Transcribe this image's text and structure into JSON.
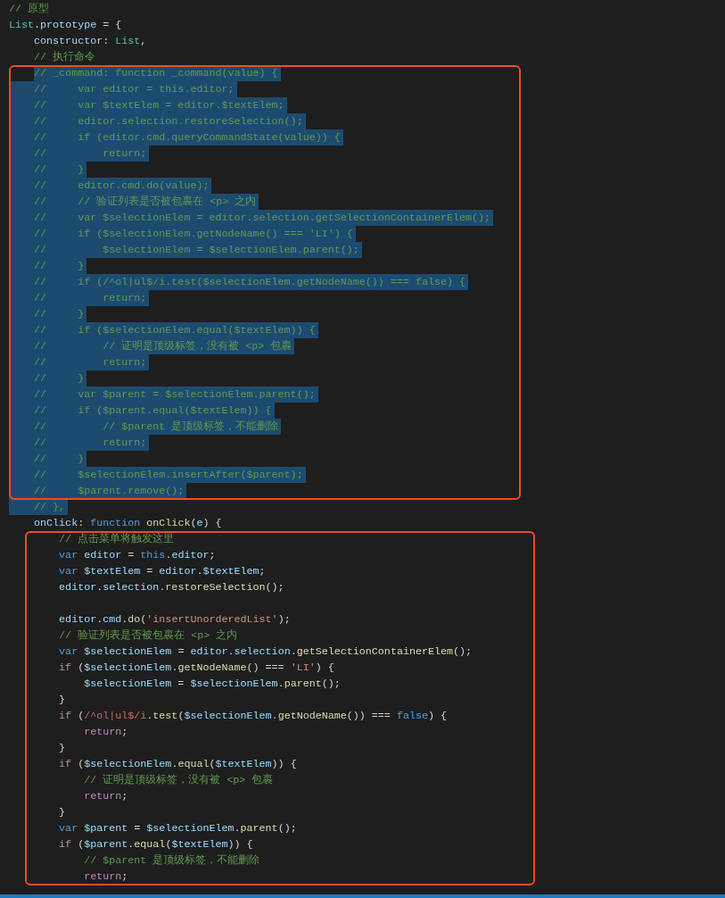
{
  "editor": {
    "lines": [
      {
        "kind": "code",
        "selected": false,
        "tokens": [
          {
            "kind": "comment",
            "text": "// 原型"
          }
        ]
      },
      {
        "kind": "code",
        "selected": false,
        "tokens": [
          {
            "kind": "type",
            "text": "List"
          },
          {
            "kind": "punct",
            "text": "."
          },
          {
            "kind": "ident",
            "text": "prototype"
          },
          {
            "kind": "punct",
            "text": " = {"
          }
        ]
      },
      {
        "kind": "code",
        "selected": false,
        "tokens": [
          {
            "kind": "ident",
            "text": "    constructor"
          },
          {
            "kind": "punct",
            "text": ": "
          },
          {
            "kind": "type",
            "text": "List"
          },
          {
            "kind": "punct",
            "text": ","
          }
        ]
      },
      {
        "kind": "code",
        "selected": false,
        "tokens": [
          {
            "kind": "comment",
            "text": "    // 执行命令"
          }
        ]
      },
      {
        "kind": "code",
        "selected": true,
        "selection_starts_at_text": true,
        "tokens": [
          {
            "kind": "comment",
            "text": "    // _command: function _command(value) {"
          }
        ]
      },
      {
        "kind": "code",
        "selected": true,
        "tokens": [
          {
            "kind": "comment",
            "text": "    //     var editor = this.editor;"
          }
        ]
      },
      {
        "kind": "code",
        "selected": true,
        "tokens": [
          {
            "kind": "comment",
            "text": "    //     var $textElem = editor.$textElem;"
          }
        ]
      },
      {
        "kind": "code",
        "selected": true,
        "tokens": [
          {
            "kind": "comment",
            "text": "    //     editor.selection.restoreSelection();"
          }
        ]
      },
      {
        "kind": "code",
        "selected": true,
        "tokens": [
          {
            "kind": "comment",
            "text": "    //     if (editor.cmd.queryCommandState(value)) {"
          }
        ]
      },
      {
        "kind": "code",
        "selected": true,
        "tokens": [
          {
            "kind": "comment",
            "text": "    //         return;"
          }
        ]
      },
      {
        "kind": "code",
        "selected": true,
        "tokens": [
          {
            "kind": "comment",
            "text": "    //     }"
          }
        ]
      },
      {
        "kind": "code",
        "selected": true,
        "tokens": [
          {
            "kind": "comment",
            "text": "    //     editor.cmd.do(value);"
          }
        ]
      },
      {
        "kind": "code",
        "selected": true,
        "tokens": [
          {
            "kind": "comment",
            "text": "    //     // 验证列表是否被包裹在 <p> 之内"
          }
        ]
      },
      {
        "kind": "code",
        "selected": true,
        "tokens": [
          {
            "kind": "comment",
            "text": "    //     var $selectionElem = editor.selection.getSelectionContainerElem();"
          }
        ]
      },
      {
        "kind": "code",
        "selected": true,
        "tokens": [
          {
            "kind": "comment",
            "text": "    //     if ($selectionElem.getNodeName() === 'LI') {"
          }
        ]
      },
      {
        "kind": "code",
        "selected": true,
        "tokens": [
          {
            "kind": "comment",
            "text": "    //         $selectionElem = $selectionElem.parent();"
          }
        ]
      },
      {
        "kind": "code",
        "selected": true,
        "tokens": [
          {
            "kind": "comment",
            "text": "    //     }"
          }
        ]
      },
      {
        "kind": "code",
        "selected": true,
        "tokens": [
          {
            "kind": "comment",
            "text": "    //     if (/^ol|ul$/i.test($selectionElem.getNodeName()) === false) {"
          }
        ]
      },
      {
        "kind": "code",
        "selected": true,
        "tokens": [
          {
            "kind": "comment",
            "text": "    //         return;"
          }
        ]
      },
      {
        "kind": "code",
        "selected": true,
        "tokens": [
          {
            "kind": "comment",
            "text": "    //     }"
          }
        ]
      },
      {
        "kind": "code",
        "selected": true,
        "tokens": [
          {
            "kind": "comment",
            "text": "    //     if ($selectionElem.equal($textElem)) {"
          }
        ]
      },
      {
        "kind": "code",
        "selected": true,
        "tokens": [
          {
            "kind": "comment",
            "text": "    //         // 证明是顶级标签，没有被 <p> 包裹"
          }
        ]
      },
      {
        "kind": "code",
        "selected": true,
        "tokens": [
          {
            "kind": "comment",
            "text": "    //         return;"
          }
        ]
      },
      {
        "kind": "code",
        "selected": true,
        "tokens": [
          {
            "kind": "comment",
            "text": "    //     }"
          }
        ]
      },
      {
        "kind": "code",
        "selected": true,
        "tokens": [
          {
            "kind": "comment",
            "text": "    //     var $parent = $selectionElem.parent();"
          }
        ]
      },
      {
        "kind": "code",
        "selected": true,
        "tokens": [
          {
            "kind": "comment",
            "text": "    //     if ($parent.equal($textElem)) {"
          }
        ]
      },
      {
        "kind": "code",
        "selected": true,
        "tokens": [
          {
            "kind": "comment",
            "text": "    //         // $parent 是顶级标签，不能删除"
          }
        ]
      },
      {
        "kind": "code",
        "selected": true,
        "tokens": [
          {
            "kind": "comment",
            "text": "    //         return;"
          }
        ]
      },
      {
        "kind": "code",
        "selected": true,
        "tokens": [
          {
            "kind": "comment",
            "text": "    //     }"
          }
        ]
      },
      {
        "kind": "code",
        "selected": true,
        "tokens": [
          {
            "kind": "comment",
            "text": "    //     $selectionElem.insertAfter($parent);"
          }
        ]
      },
      {
        "kind": "code",
        "selected": true,
        "tokens": [
          {
            "kind": "comment",
            "text": "    //     $parent.remove();"
          }
        ]
      },
      {
        "kind": "code",
        "selected": true,
        "tokens": [
          {
            "kind": "comment",
            "text": "    // },"
          }
        ]
      },
      {
        "kind": "code",
        "selected": false,
        "tokens": [
          {
            "kind": "ident",
            "text": "    onClick"
          },
          {
            "kind": "punct",
            "text": ": "
          },
          {
            "kind": "keyword",
            "text": "function "
          },
          {
            "kind": "func",
            "text": "onClick"
          },
          {
            "kind": "punct",
            "text": "("
          },
          {
            "kind": "ident",
            "text": "e"
          },
          {
            "kind": "punct",
            "text": ") {"
          }
        ]
      },
      {
        "kind": "code",
        "selected": false,
        "tokens": [
          {
            "kind": "comment",
            "text": "        // 点击菜单将触发这里"
          }
        ]
      },
      {
        "kind": "code",
        "selected": false,
        "tokens": [
          {
            "kind": "keyword",
            "text": "        var "
          },
          {
            "kind": "ident",
            "text": "editor"
          },
          {
            "kind": "punct",
            "text": " = "
          },
          {
            "kind": "keyword",
            "text": "this"
          },
          {
            "kind": "punct",
            "text": "."
          },
          {
            "kind": "ident",
            "text": "editor"
          },
          {
            "kind": "punct",
            "text": ";"
          }
        ]
      },
      {
        "kind": "code",
        "selected": false,
        "tokens": [
          {
            "kind": "keyword",
            "text": "        var "
          },
          {
            "kind": "ident",
            "text": "$textElem"
          },
          {
            "kind": "punct",
            "text": " = "
          },
          {
            "kind": "ident",
            "text": "editor"
          },
          {
            "kind": "punct",
            "text": "."
          },
          {
            "kind": "ident",
            "text": "$textElem"
          },
          {
            "kind": "punct",
            "text": ";"
          }
        ]
      },
      {
        "kind": "code",
        "selected": false,
        "tokens": [
          {
            "kind": "ident",
            "text": "        editor"
          },
          {
            "kind": "punct",
            "text": "."
          },
          {
            "kind": "ident",
            "text": "selection"
          },
          {
            "kind": "punct",
            "text": "."
          },
          {
            "kind": "func",
            "text": "restoreSelection"
          },
          {
            "kind": "punct",
            "text": "();"
          }
        ]
      },
      {
        "kind": "blank"
      },
      {
        "kind": "code",
        "selected": false,
        "tokens": [
          {
            "kind": "ident",
            "text": "        editor"
          },
          {
            "kind": "punct",
            "text": "."
          },
          {
            "kind": "ident",
            "text": "cmd"
          },
          {
            "kind": "punct",
            "text": "."
          },
          {
            "kind": "func",
            "text": "do"
          },
          {
            "kind": "punct",
            "text": "("
          },
          {
            "kind": "string",
            "text": "'insertUnorderedList'"
          },
          {
            "kind": "punct",
            "text": ");"
          }
        ]
      },
      {
        "kind": "code",
        "selected": false,
        "tokens": [
          {
            "kind": "comment",
            "text": "        // 验证列表是否被包裹在 <p> 之内"
          }
        ]
      },
      {
        "kind": "code",
        "selected": false,
        "tokens": [
          {
            "kind": "keyword",
            "text": "        var "
          },
          {
            "kind": "ident",
            "text": "$selectionElem"
          },
          {
            "kind": "punct",
            "text": " = "
          },
          {
            "kind": "ident",
            "text": "editor"
          },
          {
            "kind": "punct",
            "text": "."
          },
          {
            "kind": "ident",
            "text": "selection"
          },
          {
            "kind": "punct",
            "text": "."
          },
          {
            "kind": "func",
            "text": "getSelectionContainerElem"
          },
          {
            "kind": "punct",
            "text": "();"
          }
        ]
      },
      {
        "kind": "code",
        "selected": false,
        "tokens": [
          {
            "kind": "control",
            "text": "        if"
          },
          {
            "kind": "punct",
            "text": " ("
          },
          {
            "kind": "ident",
            "text": "$selectionElem"
          },
          {
            "kind": "punct",
            "text": "."
          },
          {
            "kind": "func",
            "text": "getNodeName"
          },
          {
            "kind": "punct",
            "text": "() === "
          },
          {
            "kind": "string",
            "text": "'LI'"
          },
          {
            "kind": "punct",
            "text": ") {"
          }
        ]
      },
      {
        "kind": "code",
        "selected": false,
        "tokens": [
          {
            "kind": "ident",
            "text": "            $selectionElem"
          },
          {
            "kind": "punct",
            "text": " = "
          },
          {
            "kind": "ident",
            "text": "$selectionElem"
          },
          {
            "kind": "punct",
            "text": "."
          },
          {
            "kind": "func",
            "text": "parent"
          },
          {
            "kind": "punct",
            "text": "();"
          }
        ]
      },
      {
        "kind": "code",
        "selected": false,
        "tokens": [
          {
            "kind": "punct",
            "text": "        }"
          }
        ]
      },
      {
        "kind": "code",
        "selected": false,
        "tokens": [
          {
            "kind": "control",
            "text": "        if"
          },
          {
            "kind": "punct",
            "text": " ("
          },
          {
            "kind": "regex",
            "text": "/^ol|ul$/i"
          },
          {
            "kind": "punct",
            "text": "."
          },
          {
            "kind": "func",
            "text": "test"
          },
          {
            "kind": "punct",
            "text": "("
          },
          {
            "kind": "ident",
            "text": "$selectionElem"
          },
          {
            "kind": "punct",
            "text": "."
          },
          {
            "kind": "func",
            "text": "getNodeName"
          },
          {
            "kind": "punct",
            "text": "()) === "
          },
          {
            "kind": "keyword",
            "text": "false"
          },
          {
            "kind": "punct",
            "text": ") {"
          }
        ]
      },
      {
        "kind": "code",
        "selected": false,
        "tokens": [
          {
            "kind": "control",
            "text": "            return"
          },
          {
            "kind": "punct",
            "text": ";"
          }
        ]
      },
      {
        "kind": "code",
        "selected": false,
        "tokens": [
          {
            "kind": "punct",
            "text": "        }"
          }
        ]
      },
      {
        "kind": "code",
        "selected": false,
        "tokens": [
          {
            "kind": "control",
            "text": "        if"
          },
          {
            "kind": "punct",
            "text": " ("
          },
          {
            "kind": "ident",
            "text": "$selectionElem"
          },
          {
            "kind": "punct",
            "text": "."
          },
          {
            "kind": "func",
            "text": "equal"
          },
          {
            "kind": "punct",
            "text": "("
          },
          {
            "kind": "ident",
            "text": "$textElem"
          },
          {
            "kind": "punct",
            "text": ")) {"
          }
        ]
      },
      {
        "kind": "code",
        "selected": false,
        "tokens": [
          {
            "kind": "comment",
            "text": "            // 证明是顶级标签，没有被 <p> 包裹"
          }
        ]
      },
      {
        "kind": "code",
        "selected": false,
        "tokens": [
          {
            "kind": "control",
            "text": "            return"
          },
          {
            "kind": "punct",
            "text": ";"
          }
        ]
      },
      {
        "kind": "code",
        "selected": false,
        "tokens": [
          {
            "kind": "punct",
            "text": "        }"
          }
        ]
      },
      {
        "kind": "code",
        "selected": false,
        "tokens": [
          {
            "kind": "keyword",
            "text": "        var "
          },
          {
            "kind": "ident",
            "text": "$parent"
          },
          {
            "kind": "punct",
            "text": " = "
          },
          {
            "kind": "ident",
            "text": "$selectionElem"
          },
          {
            "kind": "punct",
            "text": "."
          },
          {
            "kind": "func",
            "text": "parent"
          },
          {
            "kind": "punct",
            "text": "();"
          }
        ]
      },
      {
        "kind": "code",
        "selected": false,
        "tokens": [
          {
            "kind": "control",
            "text": "        if"
          },
          {
            "kind": "punct",
            "text": " ("
          },
          {
            "kind": "ident",
            "text": "$parent"
          },
          {
            "kind": "punct",
            "text": "."
          },
          {
            "kind": "func",
            "text": "equal"
          },
          {
            "kind": "punct",
            "text": "("
          },
          {
            "kind": "ident",
            "text": "$textElem"
          },
          {
            "kind": "punct",
            "text": ")) {"
          }
        ]
      },
      {
        "kind": "code",
        "selected": false,
        "tokens": [
          {
            "kind": "comment",
            "text": "            // $parent 是顶级标签，不能删除"
          }
        ]
      },
      {
        "kind": "code",
        "selected": false,
        "tokens": [
          {
            "kind": "control",
            "text": "            return"
          },
          {
            "kind": "punct",
            "text": ";"
          }
        ]
      }
    ]
  },
  "annotations": [
    {
      "kind": "rectangle"
    },
    {
      "kind": "rectangle"
    }
  ]
}
